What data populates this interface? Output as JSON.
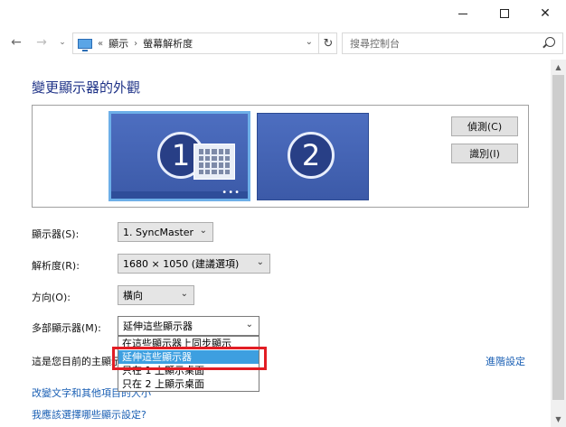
{
  "window": {
    "controls": {
      "minimize_icon": "minimize-icon",
      "maximize_icon": "maximize-icon",
      "close_glyph": "✕"
    }
  },
  "nav": {
    "back_glyph": "←",
    "forward_glyph": "→",
    "recent_glyph": "⌄",
    "breadcrumb_prefix": "«",
    "breadcrumb": [
      "顯示",
      "螢幕解析度"
    ],
    "breadcrumb_sep": "›",
    "dropdown_glyph": "⌄",
    "refresh_glyph": "↻",
    "search_placeholder": "搜尋控制台"
  },
  "main": {
    "title": "變更顯示器的外觀",
    "monitors": [
      {
        "number": "1",
        "selected": true,
        "dots": "•••"
      },
      {
        "number": "2",
        "selected": false
      }
    ],
    "detect_button": "偵測(C)",
    "identify_button": "識別(I)",
    "settings": {
      "display_label": "顯示器(S):",
      "display_value": "1. SyncMaster",
      "resolution_label": "解析度(R):",
      "resolution_value": "1680 × 1050 (建議選項)",
      "orientation_label": "方向(O):",
      "orientation_value": "橫向",
      "multi_label": "多部顯示器(M):",
      "multi_value": "延伸這些顯示器",
      "chevron": "⌄"
    },
    "multi_options": [
      "在這些顯示器上同步顯示",
      "延伸這些顯示器",
      "只在 1 上顯示桌面",
      "只在 2 上顯示桌面"
    ],
    "multi_selected_index": 1,
    "note_text": "這是您目前的主顯示器。",
    "advanced_link": "進階設定",
    "links": [
      "改變文字和其他項目的大小",
      "我應該選擇哪些顯示設定?"
    ]
  },
  "colors": {
    "title": "#1e3287",
    "link": "#1a5fb4",
    "selection": "#3d9fe0",
    "highlight": "#e21d24",
    "monitor": "#4d6ec0"
  }
}
